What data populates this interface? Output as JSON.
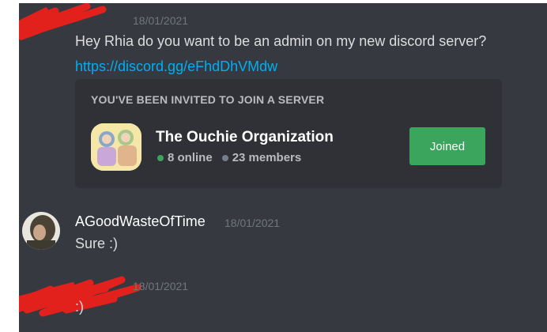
{
  "messages": [
    {
      "timestamp": "18/01/2021",
      "text": "Hey Rhia do you want to be an admin on my new discord server?",
      "link": "https://discord.gg/eFhdDhVMdw"
    },
    {
      "username": "AGoodWasteOfTime",
      "timestamp": "18/01/2021",
      "text": "Sure :)"
    },
    {
      "timestamp": "18/01/2021",
      "text": ":)"
    }
  ],
  "invite": {
    "header": "YOU'VE BEEN INVITED TO JOIN A SERVER",
    "server_name": "The Ouchie Organization",
    "online": "8 online",
    "members": "23 members",
    "button_label": "Joined"
  },
  "colors": {
    "background": "#36393f",
    "embed": "#2f3136",
    "link": "#00aff4",
    "joined_button": "#3ba55d",
    "redaction": "#e3211c"
  }
}
